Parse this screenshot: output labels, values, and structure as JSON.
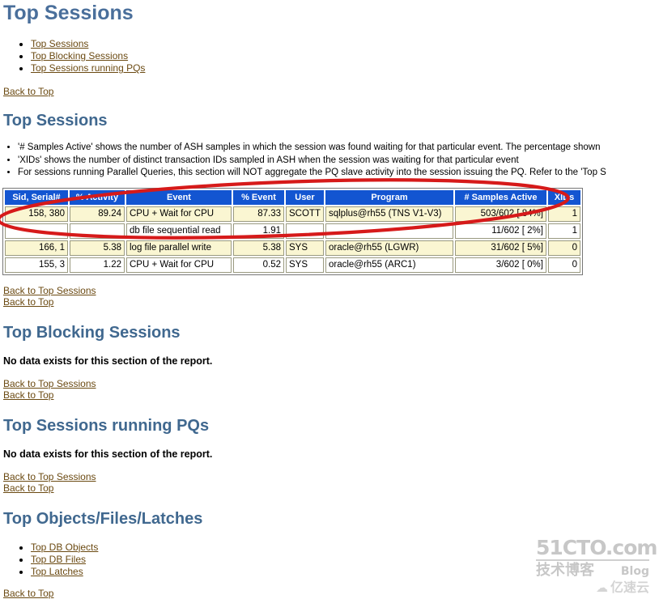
{
  "report": {
    "title": "Top Sessions",
    "index_links": [
      "Top Sessions",
      "Top Blocking Sessions",
      "Top Sessions running PQs"
    ],
    "back_to_top": "Back to Top",
    "back_to_top_sessions": "Back to Top Sessions",
    "no_data": "No data exists for this section of the report."
  },
  "top_sessions": {
    "heading": "Top Sessions",
    "notes": [
      "'# Samples Active' shows the number of ASH samples in which the session was found waiting for that particular event. The percentage shown",
      "'XIDs' shows the number of distinct transaction IDs sampled in ASH when the session was waiting for that particular event",
      "For sessions running Parallel Queries, this section will NOT aggregate the PQ slave activity into the session issuing the PQ. Refer to the 'Top S"
    ],
    "table": {
      "columns": [
        "Sid, Serial#",
        "% Activity",
        "Event",
        "% Event",
        "User",
        "Program",
        "# Samples Active",
        "XIDs"
      ],
      "rows": [
        {
          "sid_serial": "158, 380",
          "pct_activity": "89.24",
          "event": "CPU + Wait for CPU",
          "pct_event": "87.33",
          "user": "SCOTT",
          "program": "sqlplus@rh55 (TNS V1-V3)",
          "samples_active": "503/602 [ 84%]",
          "xids": "1"
        },
        {
          "sid_serial": "",
          "pct_activity": "",
          "event": "db file sequential read",
          "pct_event": "1.91",
          "user": "",
          "program": "",
          "samples_active": "11/602 [ 2%]",
          "xids": "1"
        },
        {
          "sid_serial": "166, 1",
          "pct_activity": "5.38",
          "event": "log file parallel write",
          "pct_event": "5.38",
          "user": "SYS",
          "program": "oracle@rh55 (LGWR)",
          "samples_active": "31/602 [ 5%]",
          "xids": "0"
        },
        {
          "sid_serial": "155, 3",
          "pct_activity": "1.22",
          "event": "CPU + Wait for CPU",
          "pct_event": "0.52",
          "user": "SYS",
          "program": "oracle@rh55 (ARC1)",
          "samples_active": "3/602 [ 0%]",
          "xids": "0"
        }
      ]
    }
  },
  "top_blocking_sessions": {
    "heading": "Top Blocking Sessions"
  },
  "top_sessions_pqs": {
    "heading": "Top Sessions running PQs"
  },
  "top_objects": {
    "heading": "Top Objects/Files/Latches",
    "index_links": [
      "Top DB Objects",
      "Top DB Files",
      "Top Latches"
    ]
  },
  "annotation": {
    "shape": "red-ellipse-highlight",
    "color": "#D61A1A"
  },
  "watermark": {
    "line1": "51CTO.com",
    "line2_cn": "技术博客",
    "line2_en": "Blog",
    "line3_cn": "亿速云",
    "cloud_icon": "cloud-icon",
    "color": "#9a9a9a"
  }
}
